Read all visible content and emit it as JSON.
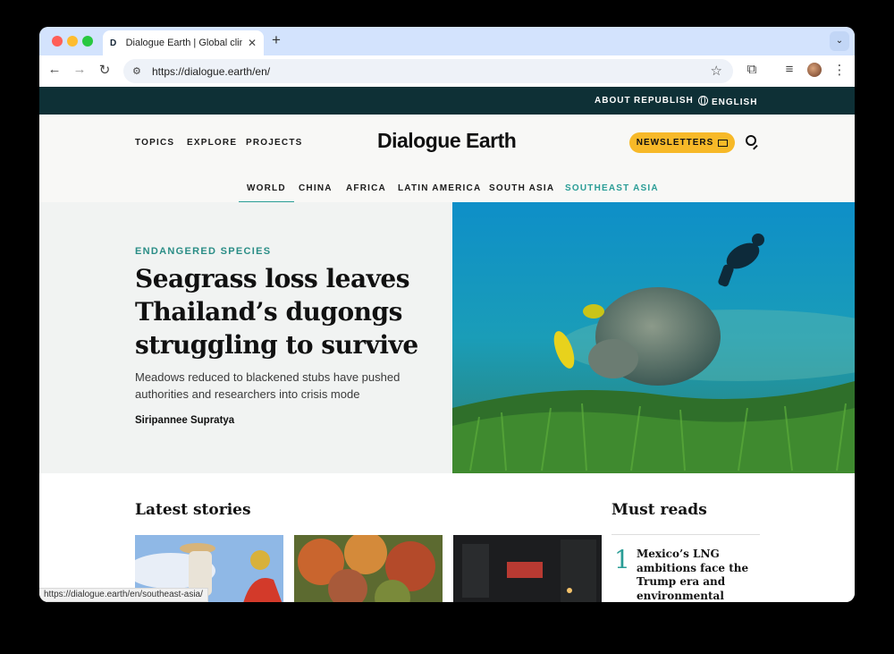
{
  "browser": {
    "tab_title": "Dialogue Earth | Global climat",
    "tab_favicon": "D",
    "tab_close": "✕",
    "new_tab": "+",
    "tab_menu": "⌄",
    "url": "https://dialogue.earth/en/",
    "status_url": "https://dialogue.earth/en/southeast-asia/",
    "icons": {
      "back": "←",
      "forward": "→",
      "reload": "↻",
      "site_info": "⚙",
      "star": "☆",
      "extensions": "⧉",
      "media": "≡",
      "menu": "⋮"
    }
  },
  "utility_nav": {
    "about": "ABOUT",
    "republish": "REPUBLISH",
    "language": "ENGLISH"
  },
  "main_nav": {
    "topics": "TOPICS",
    "explore": "EXPLORE",
    "projects": "PROJECTS",
    "logo": "Dialogue Earth",
    "newsletters": "NEWSLETTERS"
  },
  "regions": [
    "WORLD",
    "CHINA",
    "AFRICA",
    "LATIN AMERICA",
    "SOUTH ASIA",
    "SOUTHEAST ASIA"
  ],
  "hero": {
    "kicker": "ENDANGERED SPECIES",
    "headline": "Seagrass loss leaves Thailand’s dugongs struggling to survive",
    "dek": "Meadows reduced to blackened stubs have pushed authorities and researchers into crisis mode",
    "byline": "Siripannee Supratya"
  },
  "latest": {
    "title": "Latest stories"
  },
  "must_reads": {
    "title": "Must reads",
    "items": [
      {
        "number": "1",
        "title": "Mexico’s LNG ambitions face the Trump era and environmental"
      }
    ]
  },
  "colors": {
    "utility_bar": "#0e3036",
    "accent_teal": "#2a9d96",
    "newsletter_button": "#f7b928",
    "tab_strip": "#d3e3fd"
  }
}
